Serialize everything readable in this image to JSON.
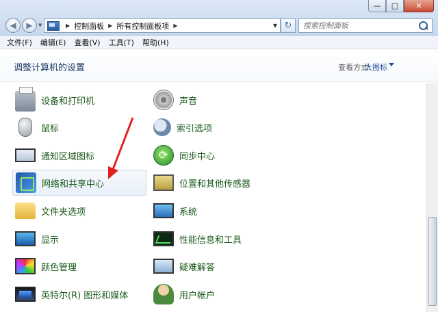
{
  "window": {
    "minimize": "—",
    "maximize": "□",
    "close": "✕"
  },
  "address": {
    "crumbs": [
      "控制面板",
      "所有控制面板项"
    ]
  },
  "search": {
    "placeholder": "搜索控制面板"
  },
  "menu": [
    "文件(F)",
    "编辑(E)",
    "查看(V)",
    "工具(T)",
    "帮助(H)"
  ],
  "header": {
    "title": "调整计算机的设置",
    "view_label": "查看方式:",
    "view_value": "大图标"
  },
  "items_left": [
    {
      "label": "设备和打印机",
      "icon": "printer-icon"
    },
    {
      "label": "鼠标",
      "icon": "mouse-icon"
    },
    {
      "label": "通知区域图标",
      "icon": "notification-area-icon"
    },
    {
      "label": "网络和共享中心",
      "icon": "network-icon"
    },
    {
      "label": "文件夹选项",
      "icon": "folder-options-icon"
    },
    {
      "label": "显示",
      "icon": "display-icon"
    },
    {
      "label": "颜色管理",
      "icon": "color-management-icon"
    },
    {
      "label": "英特尔(R) 图形和媒体",
      "icon": "intel-graphics-icon"
    }
  ],
  "items_right": [
    {
      "label": "声音",
      "icon": "sound-icon"
    },
    {
      "label": "索引选项",
      "icon": "indexing-icon"
    },
    {
      "label": "同步中心",
      "icon": "sync-center-icon"
    },
    {
      "label": "位置和其他传感器",
      "icon": "location-sensor-icon"
    },
    {
      "label": "系统",
      "icon": "system-icon"
    },
    {
      "label": "性能信息和工具",
      "icon": "performance-icon"
    },
    {
      "label": "疑难解答",
      "icon": "troubleshooting-icon"
    },
    {
      "label": "用户帐户",
      "icon": "user-accounts-icon"
    }
  ],
  "colors": {
    "item_text": "#1a5a1a",
    "title_text": "#1e3a6a",
    "annotation_arrow": "#e02020"
  }
}
